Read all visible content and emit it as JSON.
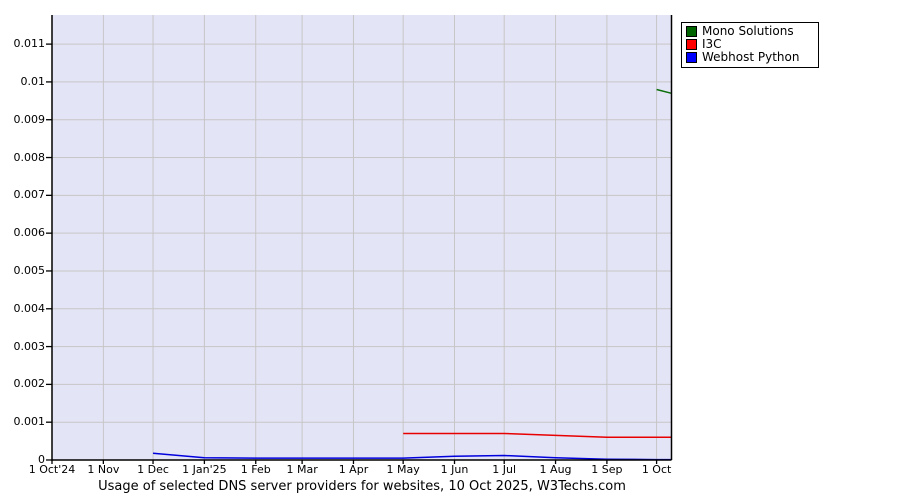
{
  "title": "Usage of selected DNS server providers for websites, 10 Oct 2025, W3Techs.com",
  "legend": {
    "items": [
      {
        "label": "Mono Solutions",
        "swatch_color": "#006400"
      },
      {
        "label": "I3C",
        "swatch_color": "#ff0000"
      },
      {
        "label": "Webhost Python",
        "swatch_color": "#0000ff"
      }
    ]
  },
  "chart_data": {
    "type": "line",
    "title": "Usage of selected DNS server providers for websites, 10 Oct 2025, W3Techs.com",
    "xlabel": "",
    "ylabel": "",
    "ylim": [
      0,
      0.01177
    ],
    "grid": true,
    "legend_position": "top-right",
    "plot_bg_color": "#e4e4f7",
    "grid_color": "#c6c6c6",
    "axis_color": "#000000",
    "x_axis": {
      "unit": "days since 1 Oct'24",
      "total_days": 374,
      "ticks": [
        {
          "label": "1 Oct'24",
          "day": 0
        },
        {
          "label": "1 Nov",
          "day": 31
        },
        {
          "label": "1 Dec",
          "day": 61
        },
        {
          "label": "1 Jan'25",
          "day": 92
        },
        {
          "label": "1 Feb",
          "day": 123
        },
        {
          "label": "1 Mar",
          "day": 151
        },
        {
          "label": "1 Apr",
          "day": 182
        },
        {
          "label": "1 May",
          "day": 212
        },
        {
          "label": "1 Jun",
          "day": 243
        },
        {
          "label": "1 Jul",
          "day": 273
        },
        {
          "label": "1 Aug",
          "day": 304
        },
        {
          "label": "1 Sep",
          "day": 335
        },
        {
          "label": "1 Oct",
          "day": 365
        }
      ]
    },
    "y_axis": {
      "ticks": [
        {
          "label": "0",
          "value": 0
        },
        {
          "label": "0.001",
          "value": 0.001
        },
        {
          "label": "0.002",
          "value": 0.002
        },
        {
          "label": "0.003",
          "value": 0.003
        },
        {
          "label": "0.004",
          "value": 0.004
        },
        {
          "label": "0.005",
          "value": 0.005
        },
        {
          "label": "0.006",
          "value": 0.006
        },
        {
          "label": "0.007",
          "value": 0.007
        },
        {
          "label": "0.008",
          "value": 0.008
        },
        {
          "label": "0.009",
          "value": 0.009
        },
        {
          "label": "0.01",
          "value": 0.01
        },
        {
          "label": "0.011",
          "value": 0.011
        }
      ]
    },
    "series": [
      {
        "name": "Mono Solutions",
        "color": "#0b6e0b",
        "points": [
          {
            "day": 365,
            "value": 0.0098
          },
          {
            "day": 374,
            "value": 0.0097
          }
        ]
      },
      {
        "name": "I3C",
        "color": "#e80000",
        "points": [
          {
            "day": 212,
            "value": 0.0007
          },
          {
            "day": 243,
            "value": 0.0007
          },
          {
            "day": 273,
            "value": 0.0007
          },
          {
            "day": 304,
            "value": 0.00065
          },
          {
            "day": 335,
            "value": 0.0006
          },
          {
            "day": 365,
            "value": 0.0006
          },
          {
            "day": 374,
            "value": 0.0006
          }
        ]
      },
      {
        "name": "Webhost Python",
        "color": "#0000dd",
        "points": [
          {
            "day": 61,
            "value": 0.00018
          },
          {
            "day": 92,
            "value": 6e-05
          },
          {
            "day": 123,
            "value": 5e-05
          },
          {
            "day": 151,
            "value": 5e-05
          },
          {
            "day": 182,
            "value": 5e-05
          },
          {
            "day": 212,
            "value": 5e-05
          },
          {
            "day": 243,
            "value": 0.0001
          },
          {
            "day": 273,
            "value": 0.00012
          },
          {
            "day": 304,
            "value": 6e-05
          },
          {
            "day": 335,
            "value": 2e-05
          },
          {
            "day": 365,
            "value": 1e-05
          },
          {
            "day": 374,
            "value": 1e-05
          }
        ]
      }
    ]
  }
}
